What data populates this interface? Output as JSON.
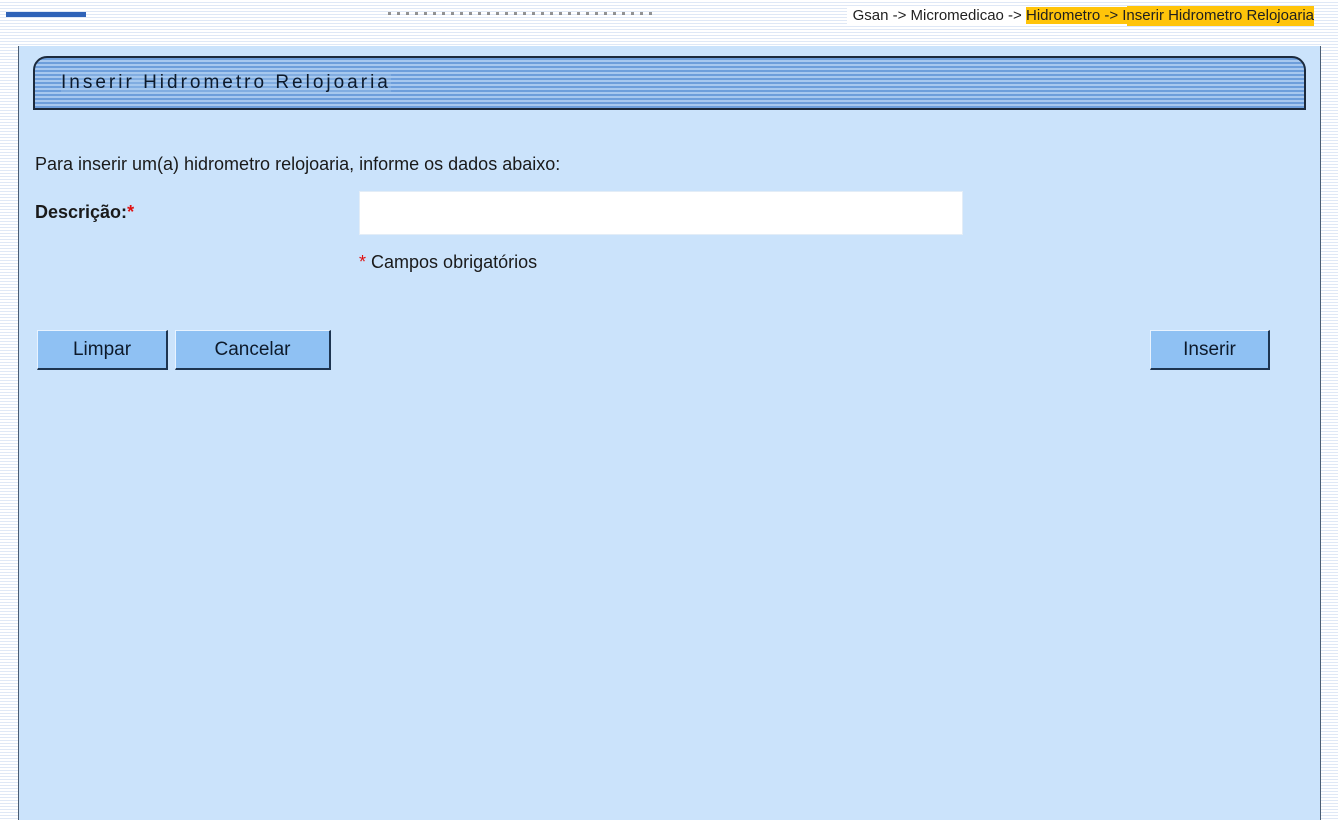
{
  "breadcrumb": {
    "prefix": "Gsan -> Micromedicao -> ",
    "highlighted": "Hidrometro -> Inserir Hidrometro Relojoaria"
  },
  "page": {
    "title": "Inserir Hidrometro Relojoaria",
    "intro": "Para inserir um(a) hidrometro relojoaria, informe os dados abaixo:"
  },
  "form": {
    "descricao_label": "Descrição:",
    "required_star": "*",
    "descricao_value": "",
    "required_note": "Campos obrigatórios"
  },
  "buttons": {
    "limpar": "Limpar",
    "cancelar": "Cancelar",
    "inserir": "Inserir"
  },
  "colors": {
    "panel_bg": "#cbe3fb",
    "title_bar": "#86b2e6",
    "button_bg": "#8fc1f3",
    "breadcrumb_highlight": "#ffc40a",
    "required": "#e01010"
  }
}
